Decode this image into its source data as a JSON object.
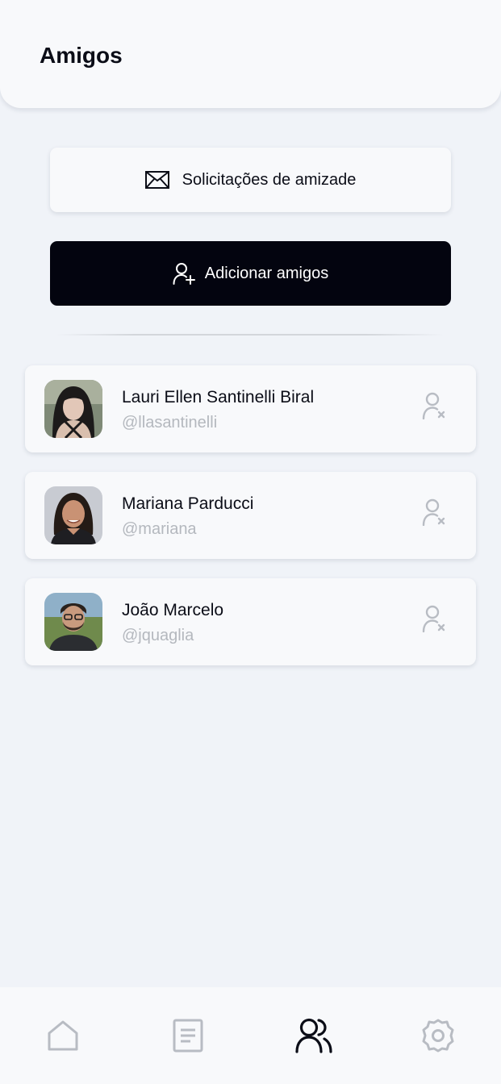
{
  "header": {
    "title": "Amigos"
  },
  "actions": {
    "requests_label": "Solicitações de amizade",
    "requests_icon": "envelope-icon",
    "add_label": "Adicionar amigos",
    "add_icon": "user-plus-icon"
  },
  "friends": [
    {
      "name": "Lauri Ellen Santinelli Biral",
      "handle": "@llasantinelli",
      "avatar": "avatar-photo",
      "remove_icon": "user-remove-icon"
    },
    {
      "name": "Mariana Parducci",
      "handle": "@mariana",
      "avatar": "avatar-photo",
      "remove_icon": "user-remove-icon"
    },
    {
      "name": "João Marcelo",
      "handle": "@jquaglia",
      "avatar": "avatar-photo",
      "remove_icon": "user-remove-icon"
    }
  ],
  "bottom_nav": {
    "items": [
      {
        "icon": "home-icon",
        "active": false
      },
      {
        "icon": "document-icon",
        "active": false
      },
      {
        "icon": "users-icon",
        "active": true
      },
      {
        "icon": "gear-icon",
        "active": false
      }
    ]
  },
  "colors": {
    "background": "#f0f3f8",
    "surface": "#f8f9fb",
    "primary_button": "#03040f",
    "text": "#0b0d17",
    "muted_text": "#b4b8be",
    "icon_inactive": "#b8bcc3"
  }
}
